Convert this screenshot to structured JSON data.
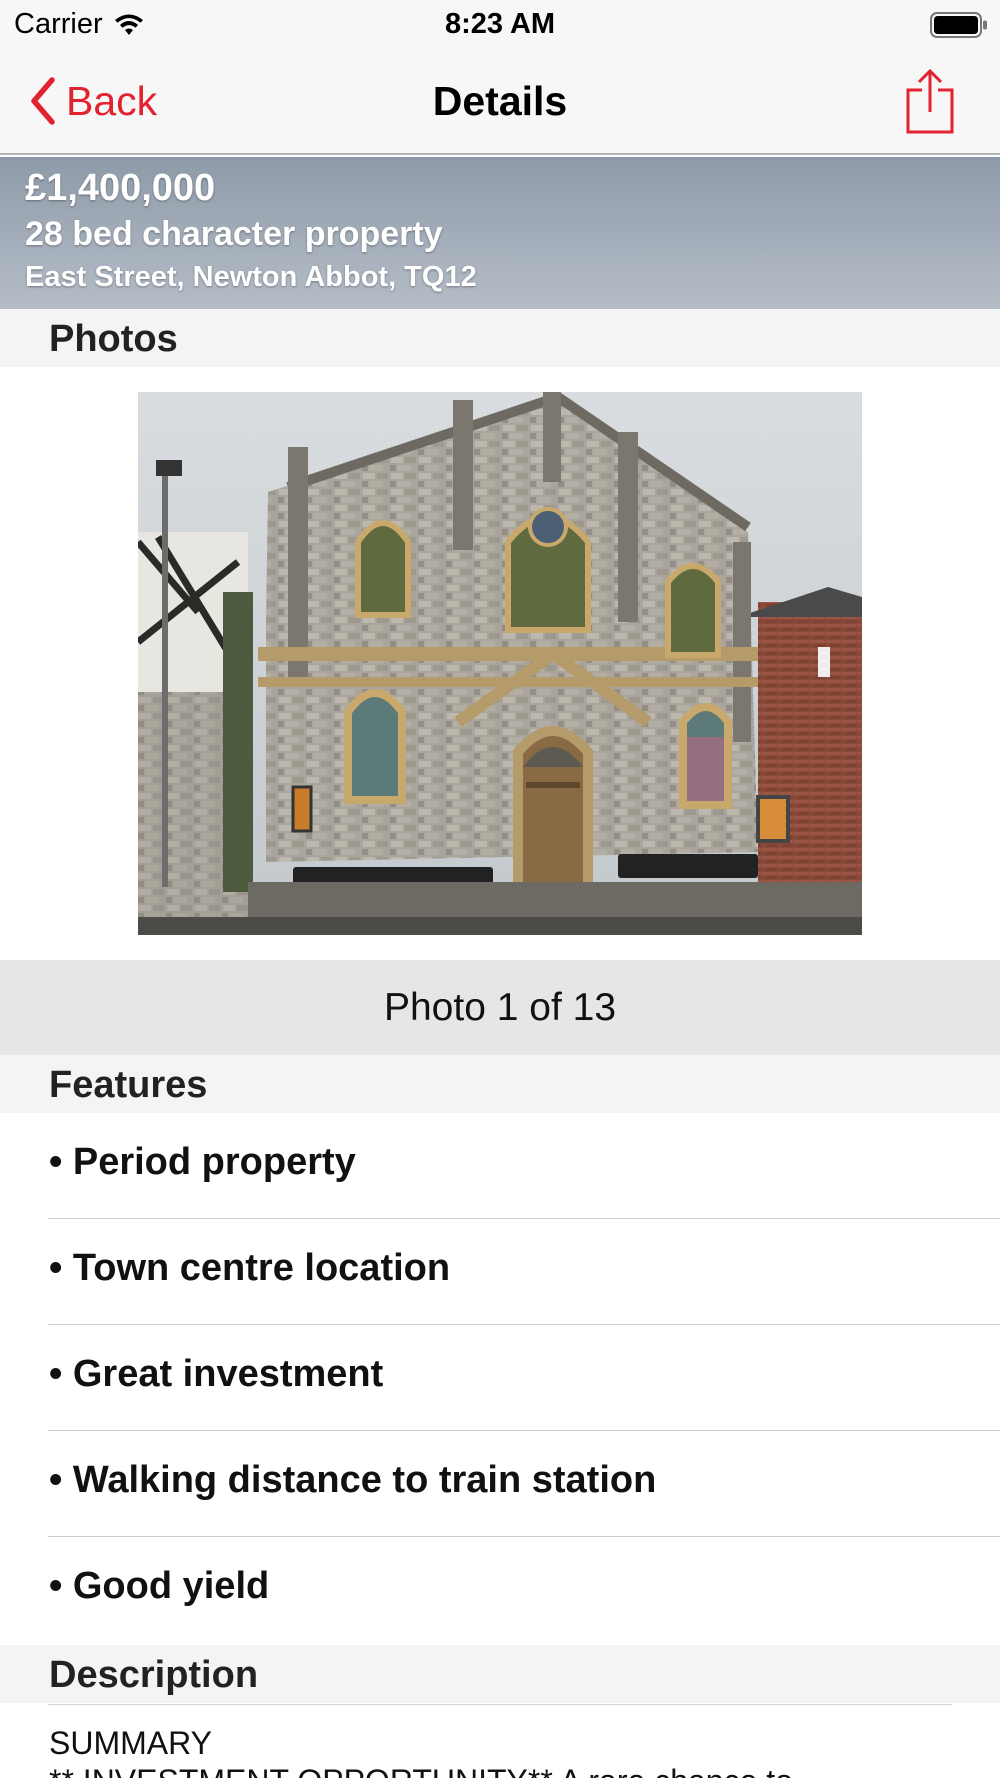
{
  "status_bar": {
    "carrier": "Carrier",
    "time": "8:23 AM"
  },
  "nav": {
    "back_label": "Back",
    "title": "Details",
    "accent_color": "#e0232e"
  },
  "listing": {
    "price": "£1,400,000",
    "summary": "28 bed character property",
    "address": "East Street, Newton Abbot, TQ12"
  },
  "photos": {
    "header": "Photos",
    "counter": "Photo 1 of 13"
  },
  "features": {
    "header": "Features",
    "items": [
      "• Period property",
      "• Town centre location",
      "• Great investment",
      "• Walking distance to train station",
      "• Good yield"
    ]
  },
  "description": {
    "header": "Description",
    "line1": "SUMMARY",
    "line2": "** INVESTMENT OPPORTUNITY** A rare chance to"
  }
}
